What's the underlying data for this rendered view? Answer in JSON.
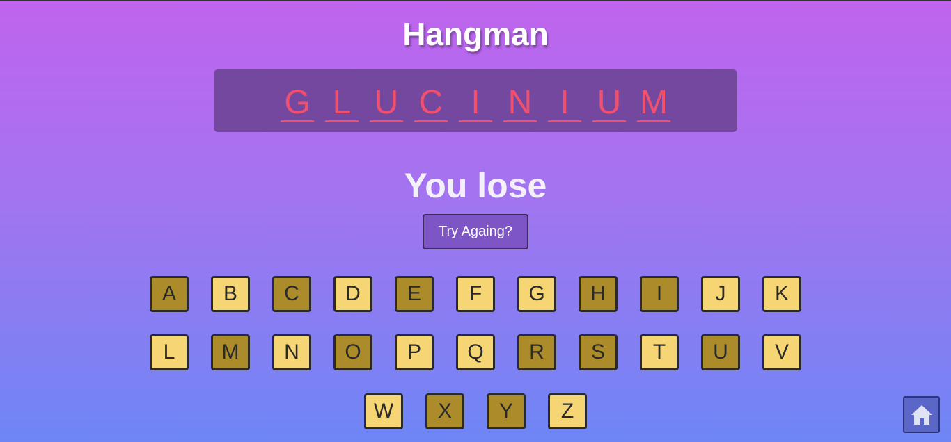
{
  "header": {
    "title": "Hangman"
  },
  "word": {
    "letters": [
      "G",
      "L",
      "U",
      "C",
      "I",
      "N",
      "I",
      "U",
      "M"
    ]
  },
  "result": {
    "message": "You lose",
    "try_again_label": "Try Againg?"
  },
  "keyboard": {
    "rows": [
      [
        {
          "letter": "A",
          "used": true
        },
        {
          "letter": "B",
          "used": false
        },
        {
          "letter": "C",
          "used": true
        },
        {
          "letter": "D",
          "used": false
        },
        {
          "letter": "E",
          "used": true
        },
        {
          "letter": "F",
          "used": false
        },
        {
          "letter": "G",
          "used": false
        },
        {
          "letter": "H",
          "used": true
        },
        {
          "letter": "I",
          "used": true
        },
        {
          "letter": "J",
          "used": false
        },
        {
          "letter": "K",
          "used": false
        }
      ],
      [
        {
          "letter": "L",
          "used": false
        },
        {
          "letter": "M",
          "used": true
        },
        {
          "letter": "N",
          "used": false
        },
        {
          "letter": "O",
          "used": true
        },
        {
          "letter": "P",
          "used": false
        },
        {
          "letter": "Q",
          "used": false
        },
        {
          "letter": "R",
          "used": true
        },
        {
          "letter": "S",
          "used": true
        },
        {
          "letter": "T",
          "used": false
        },
        {
          "letter": "U",
          "used": true
        },
        {
          "letter": "V",
          "used": false
        }
      ],
      [
        {
          "letter": "W",
          "used": false
        },
        {
          "letter": "X",
          "used": true
        },
        {
          "letter": "Y",
          "used": true
        },
        {
          "letter": "Z",
          "used": false
        }
      ]
    ]
  },
  "home": {
    "icon": "home-icon"
  },
  "colors": {
    "missing_letter": "#f0506e",
    "key_used": "#ab8b2a",
    "key_unused": "#f6d674"
  }
}
